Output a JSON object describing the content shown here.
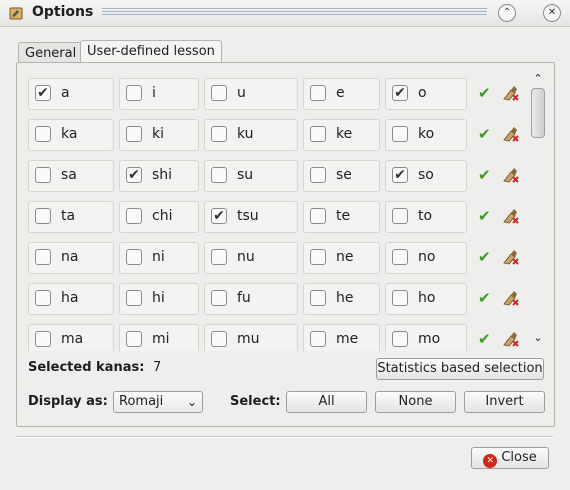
{
  "window": {
    "title": "Options"
  },
  "title_buttons": {
    "shade_glyph": "⌃",
    "close_glyph": "✕"
  },
  "tabs": [
    {
      "label": "General",
      "active": false
    },
    {
      "label": "User-defined lesson",
      "active": true
    }
  ],
  "kana_rows": [
    {
      "cells": [
        {
          "label": "a",
          "checked": true
        },
        {
          "label": "i",
          "checked": false
        },
        {
          "label": "u",
          "checked": false
        },
        {
          "label": "e",
          "checked": false
        },
        {
          "label": "o",
          "checked": true
        }
      ]
    },
    {
      "cells": [
        {
          "label": "ka",
          "checked": false
        },
        {
          "label": "ki",
          "checked": false
        },
        {
          "label": "ku",
          "checked": false
        },
        {
          "label": "ke",
          "checked": false
        },
        {
          "label": "ko",
          "checked": false
        }
      ]
    },
    {
      "cells": [
        {
          "label": "sa",
          "checked": false
        },
        {
          "label": "shi",
          "checked": true
        },
        {
          "label": "su",
          "checked": false
        },
        {
          "label": "se",
          "checked": false
        },
        {
          "label": "so",
          "checked": true
        }
      ]
    },
    {
      "cells": [
        {
          "label": "ta",
          "checked": false
        },
        {
          "label": "chi",
          "checked": false
        },
        {
          "label": "tsu",
          "checked": true
        },
        {
          "label": "te",
          "checked": false
        },
        {
          "label": "to",
          "checked": false
        }
      ]
    },
    {
      "cells": [
        {
          "label": "na",
          "checked": false
        },
        {
          "label": "ni",
          "checked": false
        },
        {
          "label": "nu",
          "checked": false
        },
        {
          "label": "ne",
          "checked": false
        },
        {
          "label": "no",
          "checked": false
        }
      ]
    },
    {
      "cells": [
        {
          "label": "ha",
          "checked": false
        },
        {
          "label": "hi",
          "checked": false
        },
        {
          "label": "fu",
          "checked": false
        },
        {
          "label": "he",
          "checked": false
        },
        {
          "label": "ho",
          "checked": false
        }
      ]
    },
    {
      "cells": [
        {
          "label": "ma",
          "checked": false
        },
        {
          "label": "mi",
          "checked": false
        },
        {
          "label": "mu",
          "checked": false
        },
        {
          "label": "me",
          "checked": false
        },
        {
          "label": "mo",
          "checked": false
        }
      ]
    }
  ],
  "row_actions": {
    "select_row_icon": "check-icon",
    "clear_row_icon": "eraser-icon",
    "check_glyph": "✔"
  },
  "scrollbar": {
    "up_glyph": "⌃",
    "down_glyph": "⌄"
  },
  "selected": {
    "label": "Selected kanas:",
    "count": "7"
  },
  "stats_button": "Statistics based selection",
  "display": {
    "label": "Display as:",
    "value": "Romaji",
    "arrow": "⌄"
  },
  "select": {
    "label": "Select:",
    "all": "All",
    "none": "None",
    "invert": "Invert"
  },
  "close_button": {
    "label": "Close",
    "icon": "close-circle-icon",
    "icon_glyph": "✕"
  },
  "colors": {
    "check_green": "#3a9a23",
    "close_red": "#d0281e",
    "eraser_red": "#cc2a2a"
  }
}
